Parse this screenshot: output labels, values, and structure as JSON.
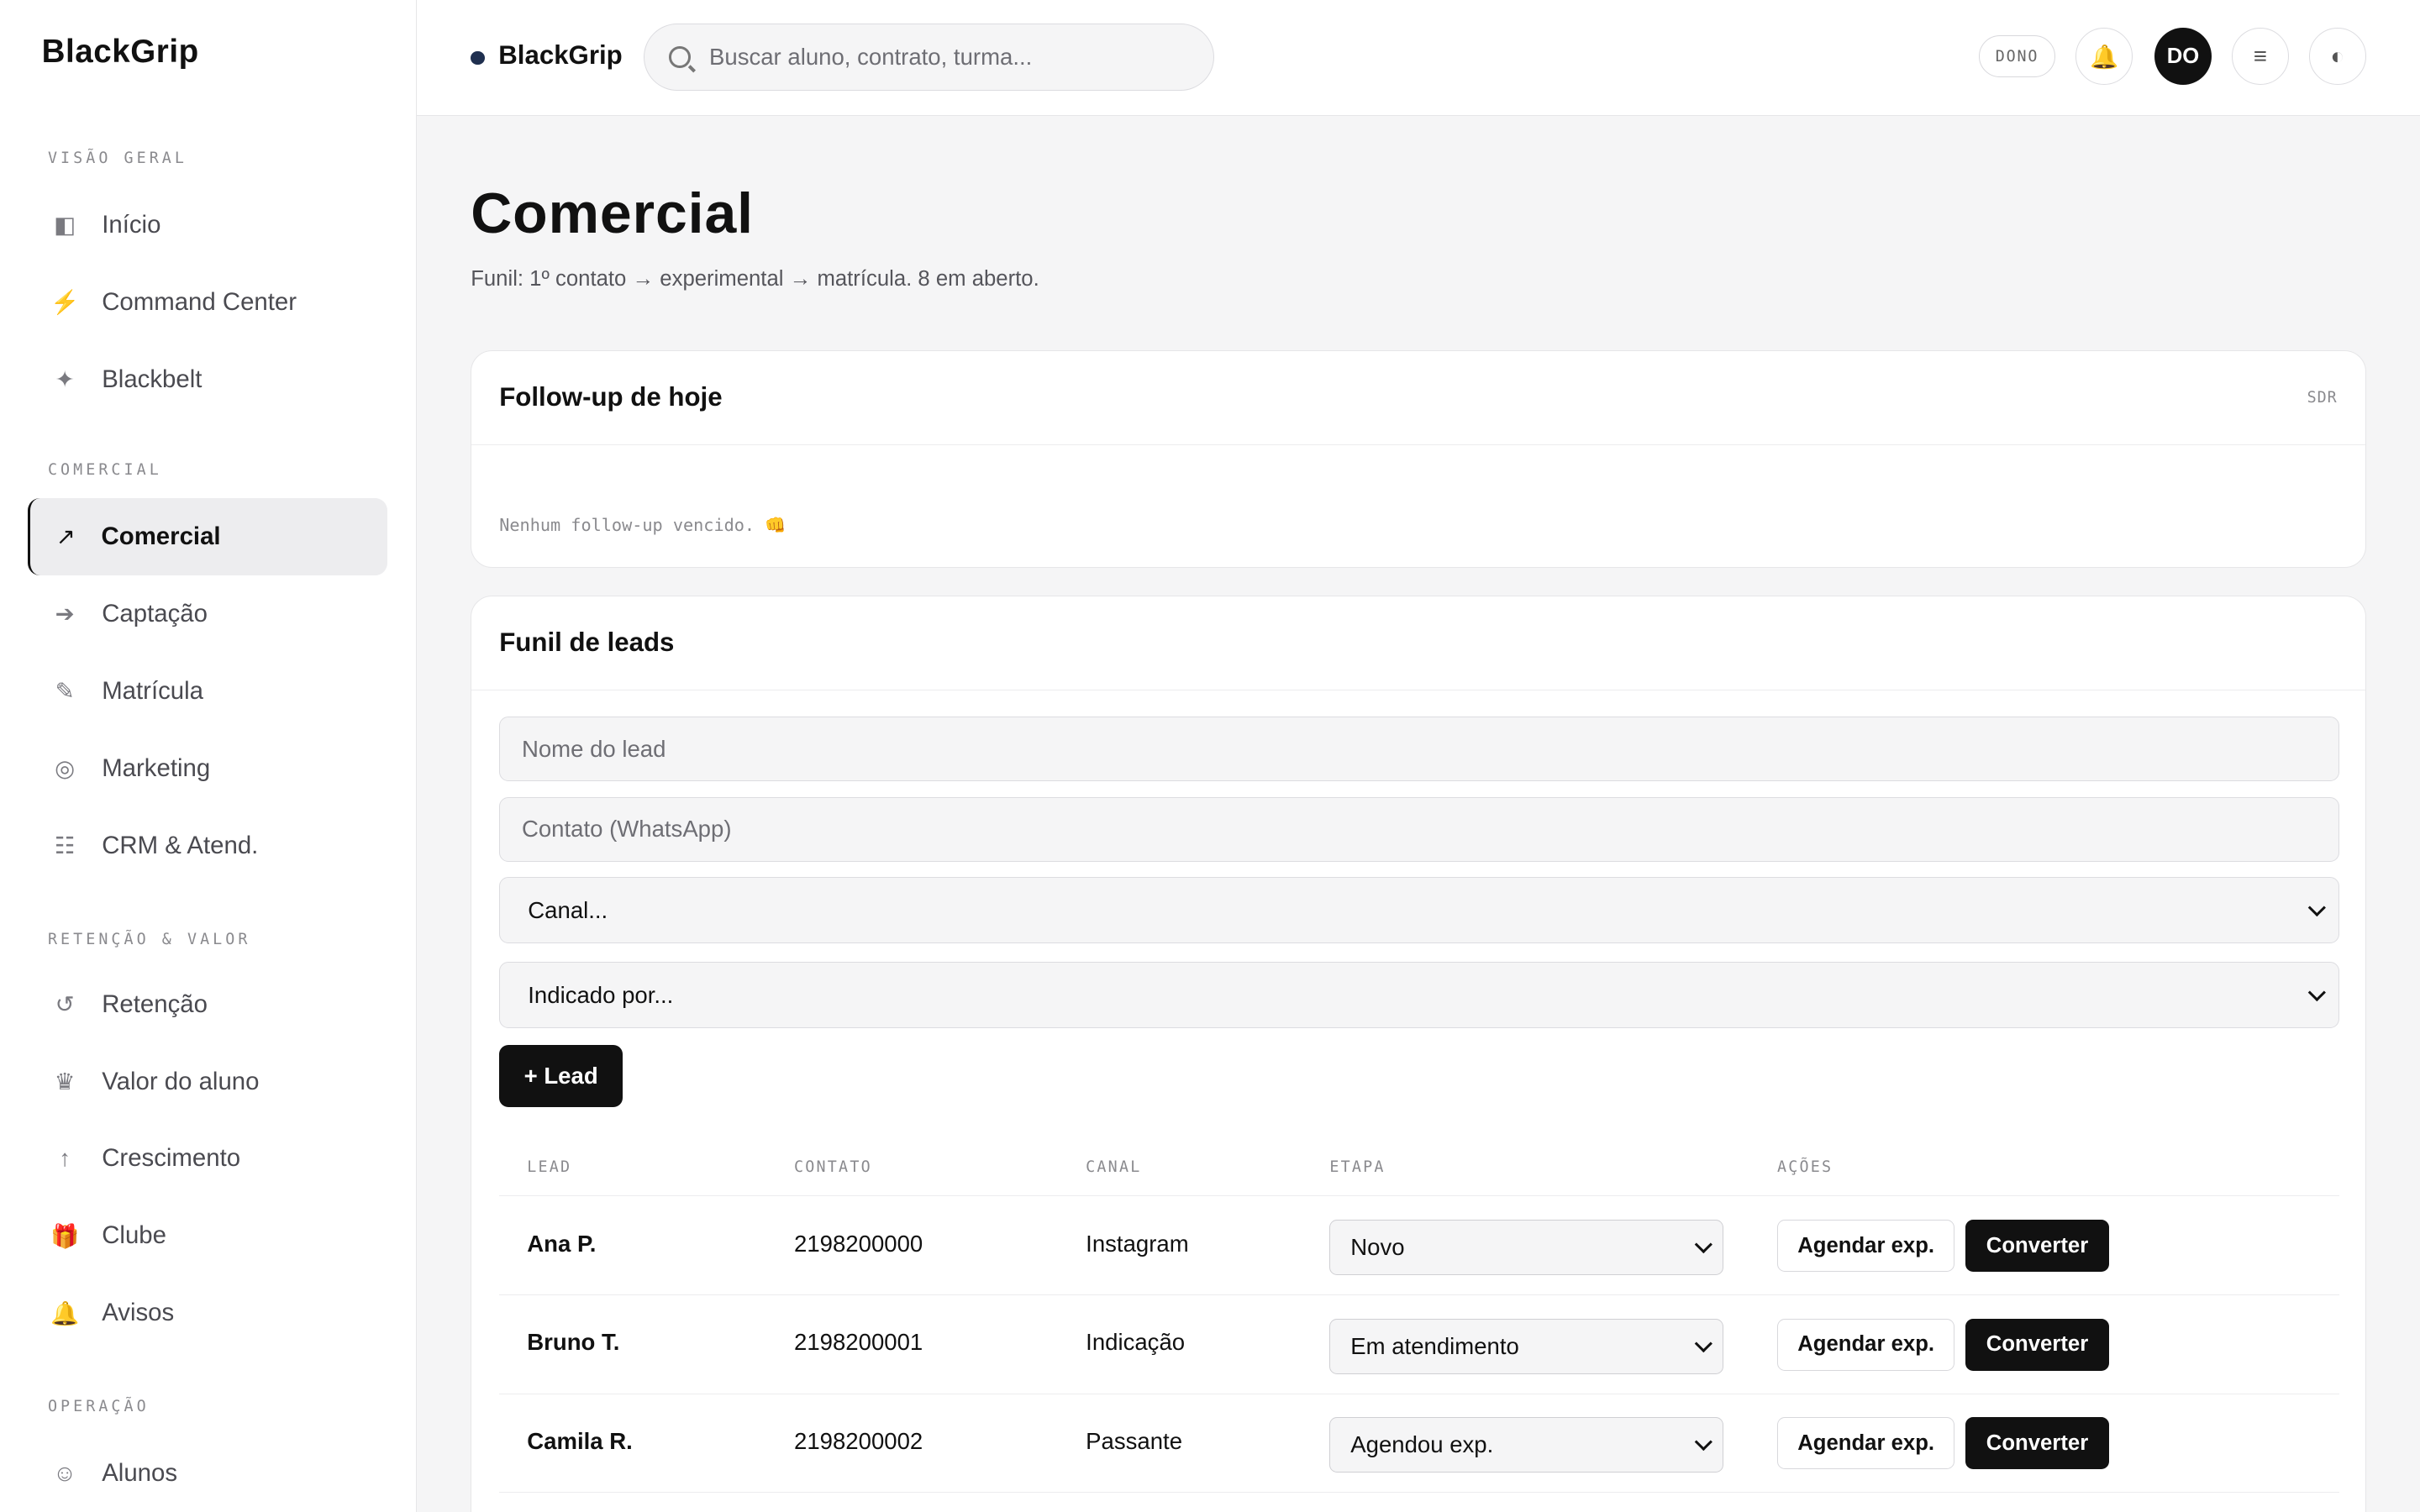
{
  "sidebar": {
    "brand": "BlackGrip",
    "sections": [
      {
        "label": "VISÃO GERAL",
        "items": [
          {
            "label": "Início",
            "icon": "◧"
          },
          {
            "label": "Command Center",
            "icon": "⚡"
          },
          {
            "label": "Blackbelt",
            "icon": "✦"
          }
        ]
      },
      {
        "label": "COMERCIAL",
        "items": [
          {
            "label": "Comercial",
            "icon": "↗"
          },
          {
            "label": "Captação",
            "icon": "➔"
          },
          {
            "label": "Matrícula",
            "icon": "✎"
          },
          {
            "label": "Marketing",
            "icon": "◎"
          },
          {
            "label": "CRM & Atend.",
            "icon": "☷"
          }
        ]
      },
      {
        "label": "RETENÇÃO & VALOR",
        "items": [
          {
            "label": "Retenção",
            "icon": "↺"
          },
          {
            "label": "Valor do aluno",
            "icon": "♛"
          },
          {
            "label": "Crescimento",
            "icon": "↑"
          },
          {
            "label": "Clube",
            "icon": "🎁"
          },
          {
            "label": "Avisos",
            "icon": "🔔"
          }
        ]
      },
      {
        "label": "OPERAÇÃO",
        "items": [
          {
            "label": "Alunos",
            "icon": "☺"
          }
        ]
      }
    ]
  },
  "topbar": {
    "brand": "BlackGrip",
    "search_placeholder": "Buscar aluno, contrato, turma...",
    "role": "DONO",
    "bell_icon": "🔔",
    "avatar": "DO",
    "menu_icon": "≡",
    "theme_icon": "◐"
  },
  "page": {
    "title": "Comercial",
    "subtitle": "Funil: 1º contato → experimental → matrícula. 8 em aberto."
  },
  "followup": {
    "title": "Follow-up de hoje",
    "tag": "SDR",
    "empty": "Nenhum follow-up vencido. 👊"
  },
  "funnel": {
    "title": "Funil de leads",
    "name_placeholder": "Nome do lead",
    "contact_placeholder": "Contato (WhatsApp)",
    "channel_select": "Canal...",
    "referral_select": "Indicado por...",
    "add_button": "+ Lead",
    "columns": [
      "LEAD",
      "CONTATO",
      "CANAL",
      "ETAPA",
      "AÇÕES"
    ],
    "rows": [
      {
        "lead": "Ana P.",
        "contact": "2198200000",
        "channel": "Instagram",
        "stage": "Novo"
      },
      {
        "lead": "Bruno T.",
        "contact": "2198200001",
        "channel": "Indicação",
        "stage": "Em atendimento"
      },
      {
        "lead": "Camila R.",
        "contact": "2198200002",
        "channel": "Passante",
        "stage": "Agendou exp."
      }
    ],
    "schedule_label": "Agendar exp.",
    "convert_label": "Converter"
  }
}
